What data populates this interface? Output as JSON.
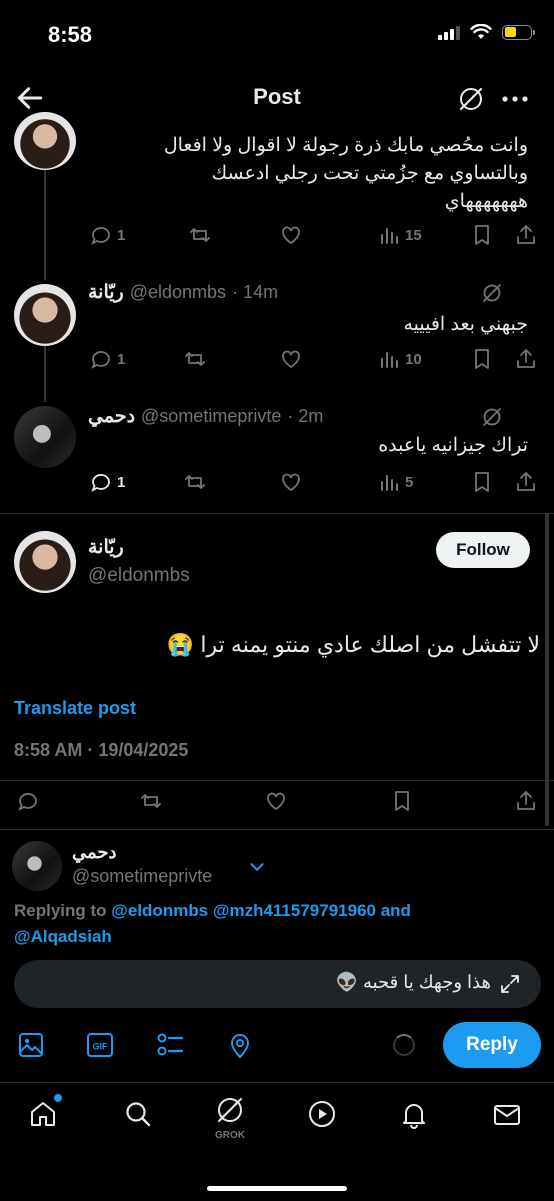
{
  "status_bar": {
    "time": "8:58"
  },
  "header": {
    "title": "Post"
  },
  "colors": {
    "accent": "#1d9bf0",
    "muted": "#71767b",
    "background": "#000000"
  },
  "thread": [
    {
      "text_lines": [
        "وانت محُصي مابك ذرة رجولة لا اقوال ولا افعال",
        "وبالتساوي مع جزُمتي تحت رجلي ادعسك",
        "هههههههاي"
      ],
      "replies": "1",
      "views": "15"
    },
    {
      "name": "ريّانة",
      "handle": "@eldonmbs",
      "time": "· 14m",
      "text": "جبهني بعد افيييه",
      "replies": "1",
      "views": "10"
    },
    {
      "name": "دحمي",
      "handle": "@sometimeprivte",
      "time": "· 2m",
      "text": "تراك جيزانيه ياعبده",
      "replies": "1",
      "views": "5"
    }
  ],
  "main_post": {
    "name": "ريّانة",
    "handle": "@eldonmbs",
    "follow_label": "Follow",
    "text": "لا تتفشل من اصلك عادي منتو يمنه ترا 😭",
    "translate_label": "Translate post",
    "timestamp": "8:58 AM · 19/04/2025"
  },
  "composer": {
    "account_name": "دحمي",
    "account_handle": "@sometimeprivte",
    "replying_prefix": "Replying to",
    "replying_handles": "@eldonmbs @mzh411579791960",
    "replying_and": "and",
    "replying_last": "@Alqadsiah",
    "draft_text": "هذا وجهك يا قحبه 👽",
    "reply_label": "Reply"
  },
  "tab_bar": {
    "grok_label": "GROK"
  },
  "icons": [
    "back-arrow-icon",
    "grok-icon",
    "more-icon",
    "comment-icon",
    "retweet-icon",
    "heart-icon",
    "views-icon",
    "bookmark-icon",
    "share-icon",
    "image-icon",
    "gif-icon",
    "poll-icon",
    "location-icon",
    "expand-icon",
    "home-icon",
    "search-icon",
    "play-icon",
    "bell-icon",
    "mail-icon"
  ]
}
